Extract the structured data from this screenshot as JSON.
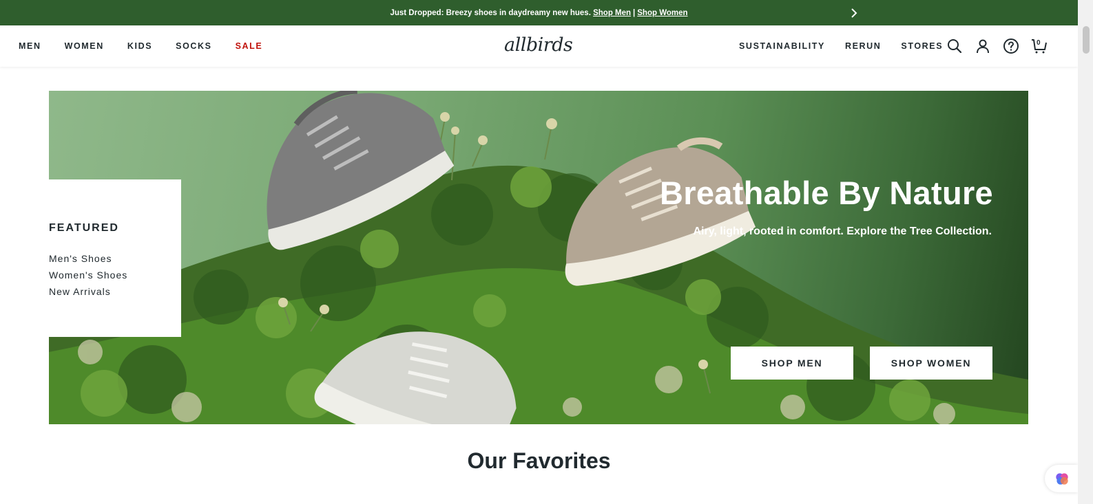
{
  "promo": {
    "text": "Just Dropped: Breezy shoes in daydreamy new hues.",
    "link_men": "Shop Men",
    "separator": "|",
    "link_women": "Shop Women"
  },
  "nav_left": [
    "MEN",
    "WOMEN",
    "KIDS",
    "SOCKS",
    "SALE"
  ],
  "logo": "allbirds",
  "nav_right": [
    "SUSTAINABILITY",
    "RERUN",
    "STORES"
  ],
  "icons": [
    "search-icon",
    "account-icon",
    "help-icon",
    "cart-icon"
  ],
  "cart_count": "0",
  "featured": {
    "heading": "FEATURED",
    "links": [
      "Men's Shoes",
      "Women's Shoes",
      "New Arrivals"
    ]
  },
  "hero": {
    "title": "Breathable By Nature",
    "subtitle": "Airy, light, rooted in comfort. Explore the Tree Collection.",
    "btn_men": "SHOP MEN",
    "btn_women": "SHOP WOMEN"
  },
  "favorites_heading": "Our Favorites",
  "colors": {
    "promo_bg": "#2f5e2d",
    "sale": "#c0110a",
    "text": "#212a2f"
  }
}
